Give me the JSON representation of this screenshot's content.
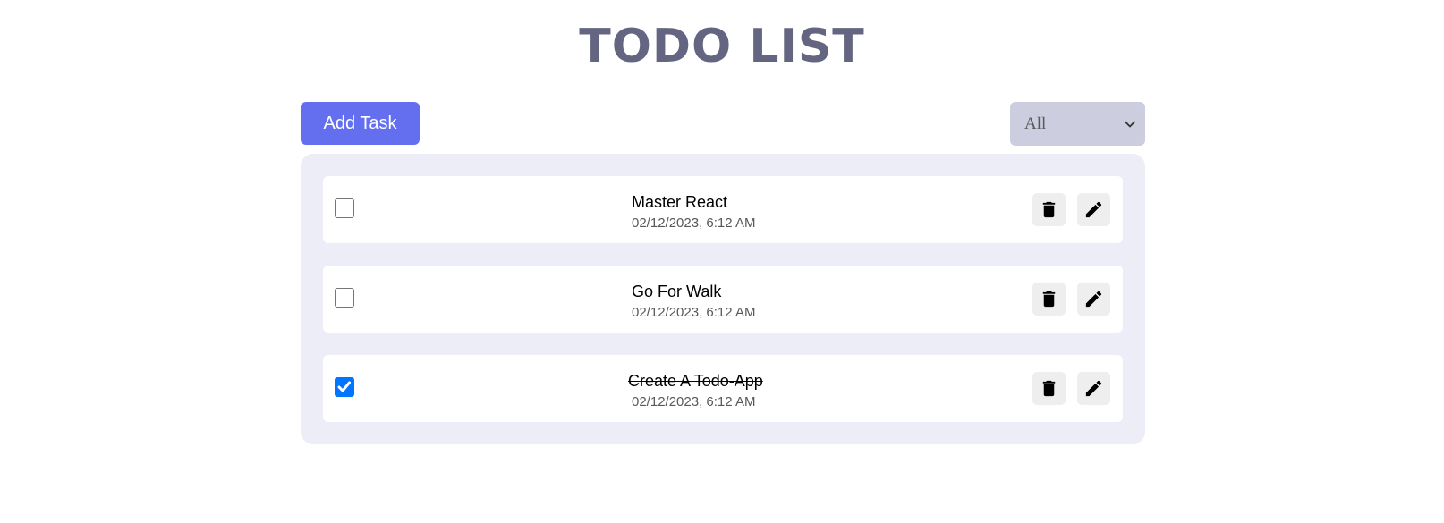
{
  "app": {
    "title": "TODO LIST"
  },
  "toolbar": {
    "add_label": "Add Task",
    "filter_value": "All"
  },
  "tasks": [
    {
      "title": "Master React",
      "time": "02/12/2023, 6:12 AM",
      "completed": false
    },
    {
      "title": "Go For Walk",
      "time": "02/12/2023, 6:12 AM",
      "completed": false
    },
    {
      "title": "Create A Todo-App",
      "time": "02/12/2023, 6:12 AM",
      "completed": true
    }
  ],
  "colors": {
    "title": "#646681",
    "accent": "#646ff0",
    "panel": "#ecedf6",
    "filter_bg": "#cccdde",
    "checkbox_checked": "#0075ff"
  },
  "icons": {
    "delete": "trash-icon",
    "edit": "pencil-icon",
    "filter": "chevron-down-icon",
    "check": "checkmark-icon"
  }
}
